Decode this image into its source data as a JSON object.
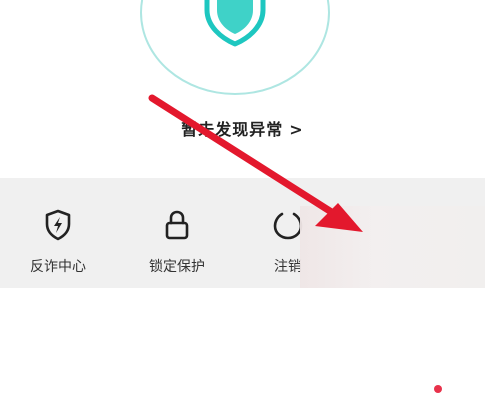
{
  "status": {
    "text": "暂未发现异常",
    "chevron": ">"
  },
  "tools": [
    {
      "label": "反诈中心",
      "icon": "shield-lightning-icon"
    },
    {
      "label": "锁定保护",
      "icon": "lock-icon"
    },
    {
      "label": "注销",
      "icon": "power-icon"
    }
  ],
  "colors": {
    "accent_teal": "#1ec7c0",
    "ring": "#aee6e2",
    "arrow_red": "#e3182d",
    "toolbar_bg": "#f0f0f0"
  }
}
